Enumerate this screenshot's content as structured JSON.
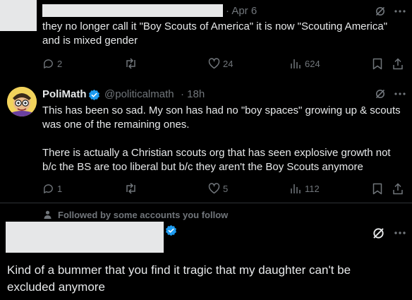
{
  "tweet1": {
    "date": "· Apr 6",
    "body_line1": "they no longer call it \"Boy Scouts of America\" it is now \"Scouting America\"",
    "body_line2": "and is mixed gender",
    "replies": "2",
    "retweets": "",
    "likes": "24",
    "views": "624"
  },
  "tweet2": {
    "name": "PoliMath",
    "handle": "@politicalmath",
    "time": "· 18h",
    "p1_line1": "This has been so sad. My son has had no \"boy spaces\" growing up & scouts",
    "p1_line2": "was one of the remaining ones.",
    "p2_line1": "There is actually a Christian scouts org that has seen explosive growth not",
    "p2_line2": "b/c the BS are too liberal but b/c they aren't the Boy Scouts anymore",
    "replies": "1",
    "likes": "5",
    "views": "112"
  },
  "social_context": "Followed by some accounts you follow",
  "tweet3": {
    "body_line1": "Kind of a bummer that you find it tragic that my daughter can't be",
    "body_line2": "excluded anymore"
  },
  "colors": {
    "background": "#000000",
    "text": "#e7e9ea",
    "secondary": "#71767b",
    "verified": "#1d9bf0"
  }
}
